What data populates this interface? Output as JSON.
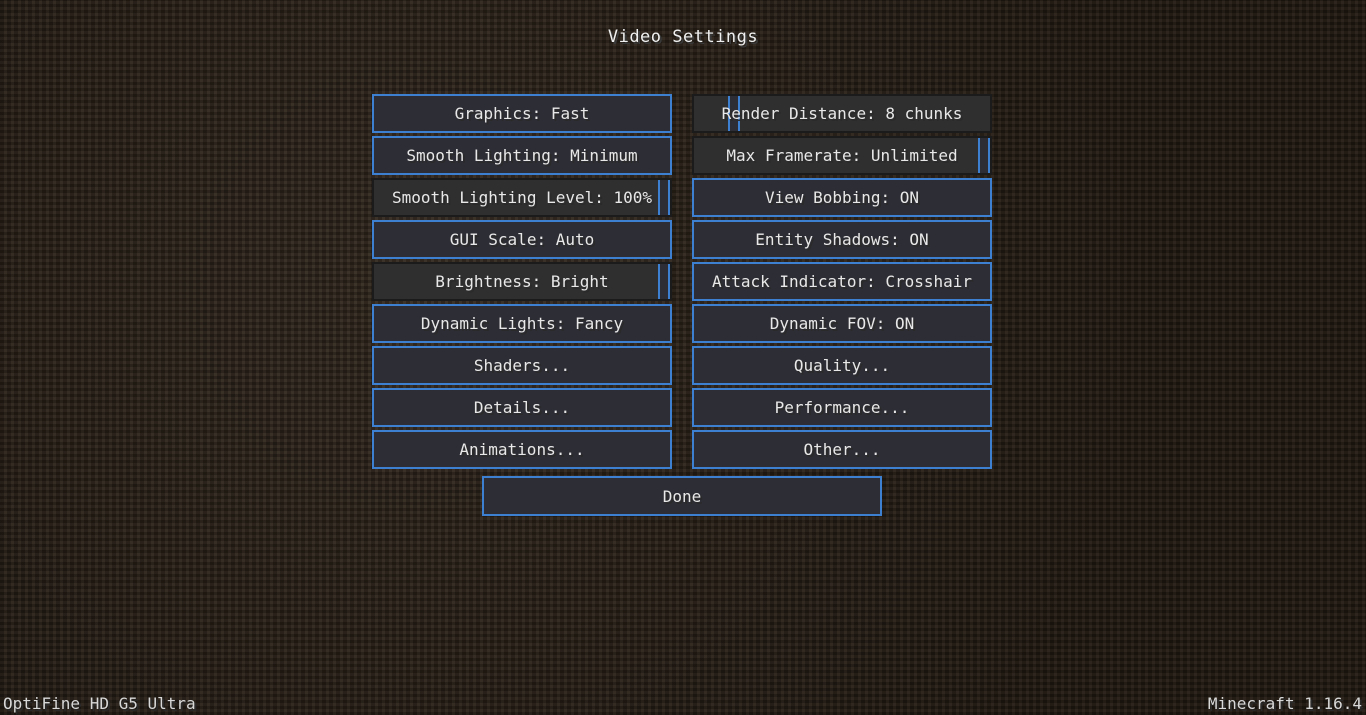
{
  "screen": {
    "title": "Video Settings",
    "accent_color": "#3d7fd1"
  },
  "left_column": {
    "graphics": "Graphics: Fast",
    "smooth_lighting": "Smooth Lighting: Minimum",
    "smooth_lighting_level": "Smooth Lighting Level: 100%",
    "gui_scale": "GUI Scale: Auto",
    "brightness": "Brightness: Bright",
    "dynamic_lights": "Dynamic Lights: Fancy",
    "shaders": "Shaders...",
    "details": "Details...",
    "animations": "Animations..."
  },
  "right_column": {
    "render_distance": "Render Distance: 8 chunks",
    "max_framerate": "Max Framerate: Unlimited",
    "view_bobbing": "View Bobbing: ON",
    "entity_shadows": "Entity Shadows: ON",
    "attack_indicator": "Attack Indicator: Crosshair",
    "dynamic_fov": "Dynamic FOV: ON",
    "quality": "Quality...",
    "performance": "Performance...",
    "other": "Other..."
  },
  "slider_values": {
    "smooth_lighting_level": 1.0,
    "brightness": 1.0,
    "render_distance": 0.12,
    "max_framerate": 1.0
  },
  "done_button": "Done",
  "footer": {
    "left": "OptiFine HD G5 Ultra",
    "right": "Minecraft 1.16.4"
  }
}
